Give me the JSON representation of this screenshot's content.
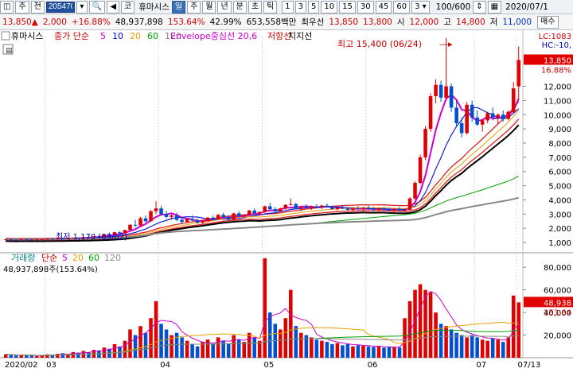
{
  "toolbar": {
    "code": "205470",
    "name": "휴마시스",
    "periods": [
      "일",
      "주",
      "월",
      "년",
      "분",
      "초",
      "틱"
    ],
    "selected_period": "일",
    "intervals": [
      "1",
      "3",
      "5",
      "10",
      "15",
      "30",
      "45",
      "60"
    ],
    "interval_sel": "3",
    "count": "100/600",
    "date": "2020/07/1",
    "letters": [
      "주",
      "전"
    ]
  },
  "quote": {
    "price": "13,850",
    "change": "2,000",
    "change_pct": "+16.88%",
    "volume": "48,937,898",
    "vol_ratio": "153.64%",
    "turnover": "42.99%",
    "amount": "653,558백만",
    "best_label": "최우선",
    "ask": "13,850",
    "bid": "13,800",
    "open_label": "시",
    "open": "12,000",
    "high_label": "고",
    "high": "14,800",
    "low_label": "저",
    "low": "11,000",
    "action": "매수"
  },
  "legend": {
    "name": "휴마시스",
    "ma_label": "종가 단순",
    "ma_periods": [
      {
        "v": "5",
        "color": "#cc00cc"
      },
      {
        "v": "10",
        "color": "#0000ff"
      },
      {
        "v": "20",
        "color": "#e6a000"
      },
      {
        "v": "60",
        "color": "#00a000"
      },
      {
        "v": "120",
        "color": "#888888"
      }
    ],
    "envelope": "Envelope중심선 20,6",
    "resist": "저항선",
    "support": "지지선"
  },
  "annotations": {
    "high": "최고 15,400 (06/24)",
    "low": "최저 1,170 (03/02)",
    "lc": "LC:1083",
    "hc": "HC:-10,",
    "last_price": "13,850",
    "last_pct": "16.88%"
  },
  "vol_legend": {
    "name": "거래량",
    "ma_label": "단순",
    "periods": [
      {
        "v": "5",
        "color": "#cc00cc"
      },
      {
        "v": "20",
        "color": "#e6a000"
      },
      {
        "v": "60",
        "color": "#00a000"
      },
      {
        "v": "120",
        "color": "#888888"
      }
    ],
    "summary": "48,937,898주(153.64%)",
    "last": "48,938",
    "last_pct": "153.64"
  },
  "x_labels": [
    {
      "d": "2020/02",
      "i": 0
    },
    {
      "d": "03",
      "i": 8
    },
    {
      "d": "04",
      "i": 30
    },
    {
      "d": "05",
      "i": 50
    },
    {
      "d": "06",
      "i": 70
    },
    {
      "d": "07",
      "i": 91
    },
    {
      "d": "07/13",
      "i": 99
    }
  ],
  "price_ticks": [
    "1,000",
    "2,000",
    "3,000",
    "4,000",
    "5,000",
    "6,000",
    "7,000",
    "8,000",
    "9,000",
    "10,000",
    "11,000",
    "12,000"
  ],
  "vol_ticks": [
    "20,000",
    "40,000",
    "60,000",
    "80,000"
  ],
  "colors": {
    "up": "#e00000",
    "down": "#0050d0",
    "panel_line": "#999999"
  },
  "chart_data": {
    "type": "candlestick",
    "n": 100,
    "price_range": [
      500,
      15500
    ],
    "volume_range": [
      0,
      90000
    ],
    "candles": [
      [
        1200,
        1230,
        1180,
        1220
      ],
      [
        1220,
        1240,
        1190,
        1200
      ],
      [
        1200,
        1210,
        1170,
        1190
      ],
      [
        1190,
        1230,
        1185,
        1225
      ],
      [
        1225,
        1250,
        1200,
        1210
      ],
      [
        1210,
        1230,
        1190,
        1200
      ],
      [
        1200,
        1220,
        1180,
        1215
      ],
      [
        1215,
        1240,
        1200,
        1230
      ],
      [
        1230,
        1260,
        1210,
        1250
      ],
      [
        1250,
        1270,
        1230,
        1240
      ],
      [
        1240,
        1280,
        1230,
        1270
      ],
      [
        1270,
        1300,
        1250,
        1260
      ],
      [
        1260,
        1290,
        1240,
        1280
      ],
      [
        1280,
        1350,
        1270,
        1340
      ],
      [
        1340,
        1380,
        1300,
        1320
      ],
      [
        1320,
        1400,
        1310,
        1390
      ],
      [
        1390,
        1420,
        1350,
        1360
      ],
      [
        1360,
        1450,
        1350,
        1440
      ],
      [
        1440,
        1500,
        1400,
        1420
      ],
      [
        1420,
        1600,
        1410,
        1580
      ],
      [
        1580,
        1700,
        1500,
        1550
      ],
      [
        1550,
        1750,
        1540,
        1720
      ],
      [
        1720,
        1800,
        1600,
        1640
      ],
      [
        1640,
        1900,
        1620,
        1880
      ],
      [
        1880,
        2300,
        1850,
        2250
      ],
      [
        2250,
        2600,
        2100,
        2200
      ],
      [
        2200,
        2800,
        2150,
        2700
      ],
      [
        2700,
        2900,
        2400,
        2500
      ],
      [
        2500,
        3300,
        2450,
        3200
      ],
      [
        3200,
        3900,
        3000,
        3400
      ],
      [
        3400,
        3600,
        2900,
        3000
      ],
      [
        3000,
        3200,
        2700,
        2800
      ],
      [
        2800,
        3000,
        2600,
        2900
      ],
      [
        2900,
        3100,
        2500,
        2600
      ],
      [
        2600,
        2800,
        2300,
        2450
      ],
      [
        2450,
        2700,
        2400,
        2650
      ],
      [
        2650,
        2900,
        2500,
        2550
      ],
      [
        2550,
        2700,
        2350,
        2400
      ],
      [
        2400,
        2600,
        2300,
        2500
      ],
      [
        2500,
        2800,
        2450,
        2750
      ],
      [
        2750,
        2900,
        2600,
        2650
      ],
      [
        2650,
        3000,
        2600,
        2950
      ],
      [
        2950,
        3100,
        2700,
        2800
      ],
      [
        2800,
        2900,
        2550,
        2600
      ],
      [
        2600,
        3100,
        2580,
        3050
      ],
      [
        3050,
        3200,
        2800,
        2850
      ],
      [
        2850,
        3000,
        2700,
        2950
      ],
      [
        2950,
        3300,
        2900,
        3250
      ],
      [
        3250,
        3400,
        3000,
        3050
      ],
      [
        3050,
        3200,
        2950,
        3150
      ],
      [
        3150,
        3600,
        3100,
        3550
      ],
      [
        3550,
        3800,
        3300,
        3350
      ],
      [
        3350,
        3500,
        3100,
        3200
      ],
      [
        3200,
        3450,
        3150,
        3400
      ],
      [
        3400,
        3700,
        3300,
        3650
      ],
      [
        3650,
        4100,
        3600,
        3700
      ],
      [
        3700,
        3800,
        3350,
        3400
      ],
      [
        3400,
        3550,
        3200,
        3500
      ],
      [
        3500,
        3700,
        3400,
        3450
      ],
      [
        3450,
        3600,
        3300,
        3550
      ],
      [
        3550,
        3700,
        3450,
        3500
      ],
      [
        3500,
        3650,
        3350,
        3600
      ],
      [
        3600,
        3750,
        3450,
        3500
      ],
      [
        3500,
        3600,
        3300,
        3350
      ],
      [
        3350,
        3500,
        3250,
        3450
      ],
      [
        3450,
        3600,
        3350,
        3400
      ],
      [
        3400,
        3500,
        3250,
        3300
      ],
      [
        3300,
        3450,
        3200,
        3400
      ],
      [
        3400,
        3550,
        3300,
        3350
      ],
      [
        3350,
        3500,
        3200,
        3450
      ],
      [
        3450,
        3600,
        3300,
        3350
      ],
      [
        3350,
        3500,
        3250,
        3300
      ],
      [
        3300,
        3450,
        3200,
        3400
      ],
      [
        3400,
        3500,
        3250,
        3300
      ],
      [
        3300,
        3450,
        3200,
        3250
      ],
      [
        3250,
        3400,
        3150,
        3350
      ],
      [
        3350,
        3500,
        3200,
        3250
      ],
      [
        3250,
        3400,
        3150,
        3300
      ],
      [
        3300,
        4200,
        3280,
        4100
      ],
      [
        4100,
        5300,
        4000,
        5200
      ],
      [
        5200,
        7200,
        5100,
        7000
      ],
      [
        7000,
        9200,
        6800,
        9000
      ],
      [
        9000,
        11500,
        8800,
        11300
      ],
      [
        11300,
        12500,
        10800,
        12100
      ],
      [
        12100,
        12400,
        10900,
        11200
      ],
      [
        11200,
        15400,
        11100,
        12000
      ],
      [
        12000,
        12200,
        10200,
        10500
      ],
      [
        10500,
        11000,
        9100,
        9400
      ],
      [
        9400,
        9800,
        8400,
        8700
      ],
      [
        8700,
        10900,
        8600,
        10700
      ],
      [
        10700,
        11000,
        9500,
        9800
      ],
      [
        9800,
        10300,
        9200,
        9300
      ],
      [
        9300,
        9700,
        8800,
        9600
      ],
      [
        9600,
        10200,
        9400,
        10100
      ],
      [
        10100,
        10500,
        9600,
        9800
      ],
      [
        9800,
        10100,
        9300,
        10000
      ],
      [
        10000,
        10300,
        9500,
        9700
      ],
      [
        9700,
        10300,
        9600,
        10200
      ],
      [
        10200,
        12300,
        10100,
        11850
      ],
      [
        12000,
        14800,
        11000,
        13850
      ]
    ],
    "volumes": [
      3000,
      2500,
      2000,
      2200,
      1800,
      2000,
      1500,
      2200,
      3000,
      2500,
      3500,
      4000,
      3000,
      5000,
      4500,
      6000,
      5000,
      7000,
      6500,
      9000,
      8000,
      12000,
      10000,
      15000,
      25000,
      20000,
      28000,
      22000,
      35000,
      50000,
      30000,
      25000,
      20000,
      22000,
      18000,
      15000,
      12000,
      10000,
      14000,
      16000,
      12000,
      18000,
      15000,
      12000,
      20000,
      16000,
      14000,
      22000,
      18000,
      15000,
      88000,
      40000,
      30000,
      25000,
      35000,
      60000,
      28000,
      22000,
      20000,
      18000,
      16000,
      15000,
      14000,
      12000,
      13000,
      11000,
      12000,
      10000,
      11000,
      10500,
      10000,
      9500,
      10000,
      9000,
      9500,
      9200,
      9000,
      35000,
      50000,
      60000,
      65000,
      60000,
      58000,
      40000,
      30000,
      28000,
      25000,
      22000,
      20000,
      18000,
      20000,
      18000,
      16000,
      15000,
      17000,
      16000,
      14000,
      18000,
      55000,
      48938
    ]
  }
}
